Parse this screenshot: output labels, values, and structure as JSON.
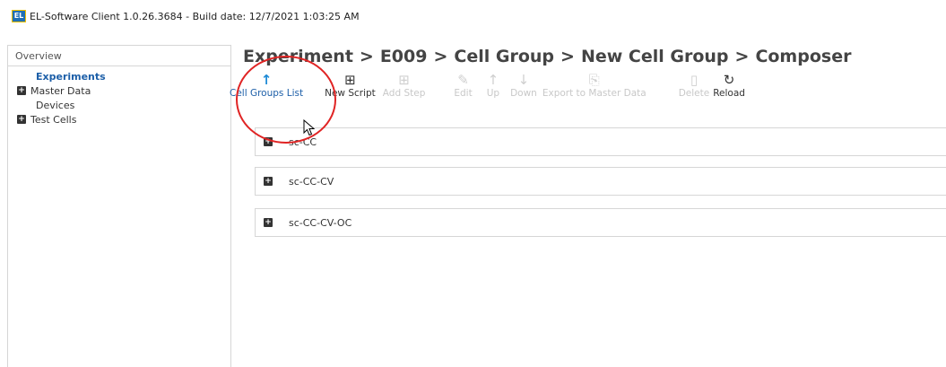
{
  "window": {
    "title": "EL-Software Client 1.0.26.3684 - Build date: 12/7/2021 1:03:25 AM",
    "icon_text": "EL"
  },
  "sidebar": {
    "header": "Overview",
    "items": [
      {
        "label": "Experiments",
        "expandable": false,
        "active": true
      },
      {
        "label": "Master Data",
        "expandable": true,
        "active": false
      },
      {
        "label": "Devices",
        "expandable": false,
        "active": false
      },
      {
        "label": "Test Cells",
        "expandable": true,
        "active": false
      }
    ]
  },
  "breadcrumb": [
    "Experiment",
    "E009",
    "Cell Group",
    "New Cell Group",
    "Composer"
  ],
  "breadcrumb_separator": ">",
  "toolbar": {
    "buttons": [
      {
        "label": "Cell Groups List",
        "icon": "arrow-up-icon",
        "state": "primary"
      },
      {
        "label": "New Script",
        "icon": "plus-box-icon",
        "state": "enabled"
      },
      {
        "label": "Add Step",
        "icon": "plus-box-icon",
        "state": "disabled"
      },
      {
        "label": "Edit",
        "icon": "edit-icon",
        "state": "disabled"
      },
      {
        "label": "Up",
        "icon": "arrow-up-icon",
        "state": "disabled"
      },
      {
        "label": "Down",
        "icon": "arrow-down-icon",
        "state": "disabled"
      },
      {
        "label": "Export to Master Data",
        "icon": "export-icon",
        "state": "disabled"
      },
      {
        "label": "Delete",
        "icon": "trash-icon",
        "state": "disabled"
      },
      {
        "label": "Reload",
        "icon": "reload-icon",
        "state": "enabled"
      }
    ]
  },
  "groups": [
    {
      "name": "sc-CC"
    },
    {
      "name": "sc-CC-CV"
    },
    {
      "name": "sc-CC-CV-OC"
    }
  ],
  "colors": {
    "accent": "#1d5fa8",
    "highlight_circle": "#e02424"
  }
}
